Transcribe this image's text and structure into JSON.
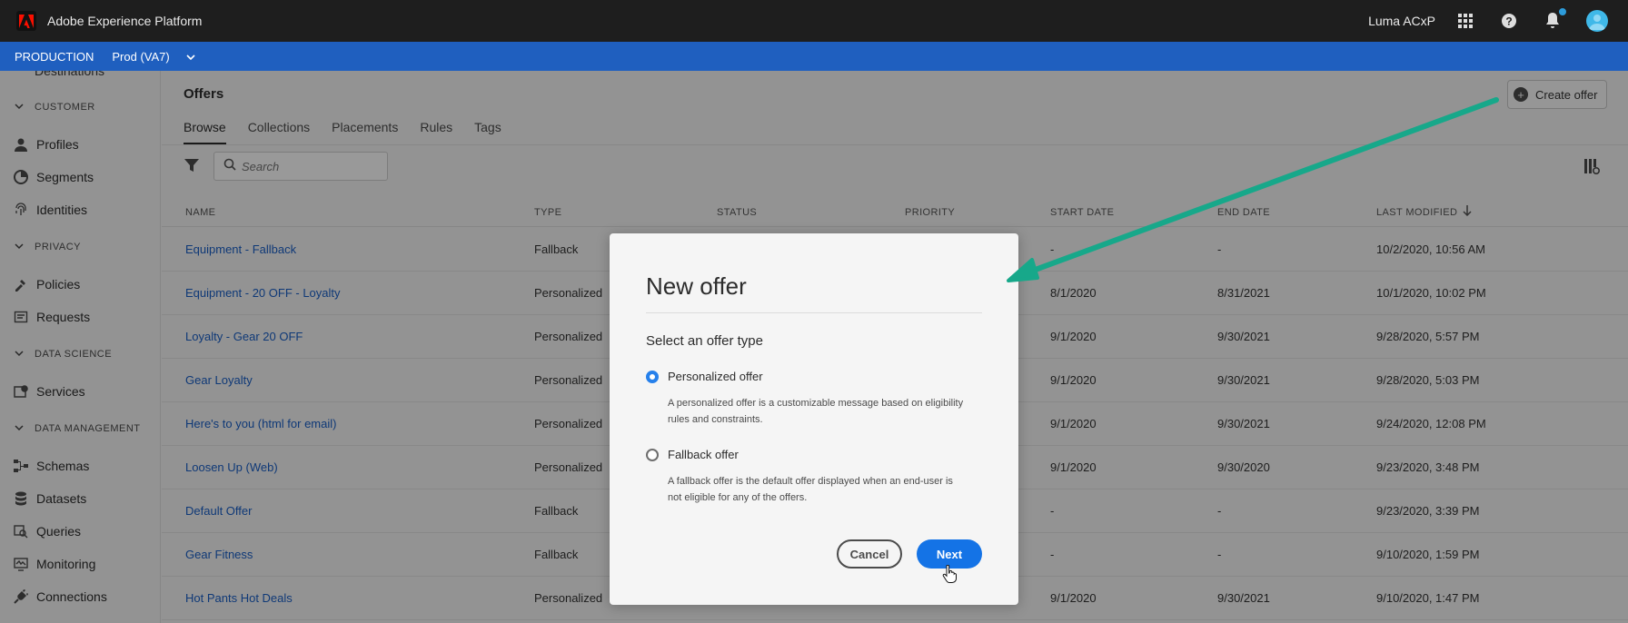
{
  "app": {
    "title": "Adobe Experience Platform",
    "org": "Luma ACxP"
  },
  "env": {
    "name": "PRODUCTION",
    "sandbox": "Prod (VA7)"
  },
  "sidebar": {
    "cut_item": "Destinations",
    "sections": [
      {
        "label": "CUSTOMER",
        "items": [
          "Profiles",
          "Segments",
          "Identities"
        ]
      },
      {
        "label": "PRIVACY",
        "items": [
          "Policies",
          "Requests"
        ]
      },
      {
        "label": "DATA SCIENCE",
        "items": [
          "Services"
        ]
      },
      {
        "label": "DATA MANAGEMENT",
        "items": [
          "Schemas",
          "Datasets",
          "Queries",
          "Monitoring",
          "Connections"
        ]
      }
    ]
  },
  "main": {
    "title": "Offers",
    "create_label": "Create offer",
    "tabs": [
      "Browse",
      "Collections",
      "Placements",
      "Rules",
      "Tags"
    ],
    "search_placeholder": "Search",
    "columns": [
      "NAME",
      "TYPE",
      "STATUS",
      "PRIORITY",
      "START DATE",
      "END DATE",
      "LAST MODIFIED"
    ],
    "rows": [
      {
        "name": "Equipment - Fallback",
        "type": "Fallback",
        "start": "-",
        "end": "-",
        "modified": "10/2/2020, 10:56 AM"
      },
      {
        "name": "Equipment - 20 OFF - Loyalty",
        "type": "Personalized",
        "start": "8/1/2020",
        "end": "8/31/2021",
        "modified": "10/1/2020, 10:02 PM"
      },
      {
        "name": "Loyalty - Gear 20 OFF",
        "type": "Personalized",
        "start": "9/1/2020",
        "end": "9/30/2021",
        "modified": "9/28/2020, 5:57 PM"
      },
      {
        "name": "Gear Loyalty",
        "type": "Personalized",
        "start": "9/1/2020",
        "end": "9/30/2021",
        "modified": "9/28/2020, 5:03 PM"
      },
      {
        "name": "Here's to you (html for email)",
        "type": "Personalized",
        "start": "9/1/2020",
        "end": "9/30/2021",
        "modified": "9/24/2020, 12:08 PM"
      },
      {
        "name": "Loosen Up (Web)",
        "type": "Personalized",
        "start": "9/1/2020",
        "end": "9/30/2020",
        "modified": "9/23/2020, 3:48 PM"
      },
      {
        "name": "Default Offer",
        "type": "Fallback",
        "start": "-",
        "end": "-",
        "modified": "9/23/2020, 3:39 PM"
      },
      {
        "name": "Gear Fitness",
        "type": "Fallback",
        "start": "-",
        "end": "-",
        "modified": "9/10/2020, 1:59 PM"
      },
      {
        "name": "Hot Pants Hot Deals",
        "type": "Personalized",
        "start": "9/1/2020",
        "end": "9/30/2021",
        "modified": "9/10/2020, 1:47 PM"
      }
    ]
  },
  "dialog": {
    "title": "New offer",
    "subtitle": "Select an offer type",
    "options": [
      {
        "label": "Personalized offer",
        "description": "A personalized offer is a customizable message based on eligibility rules and constraints.",
        "selected": true
      },
      {
        "label": "Fallback offer",
        "description": "A fallback offer is the default offer displayed when an end-user is not eligible for any of the offers.",
        "selected": false
      }
    ],
    "cancel_label": "Cancel",
    "next_label": "Next"
  },
  "colors": {
    "accent": "#1473e6",
    "env_bar": "#1f5fbf",
    "topbar": "#1e1e1e",
    "arrow": "#17a88a"
  }
}
